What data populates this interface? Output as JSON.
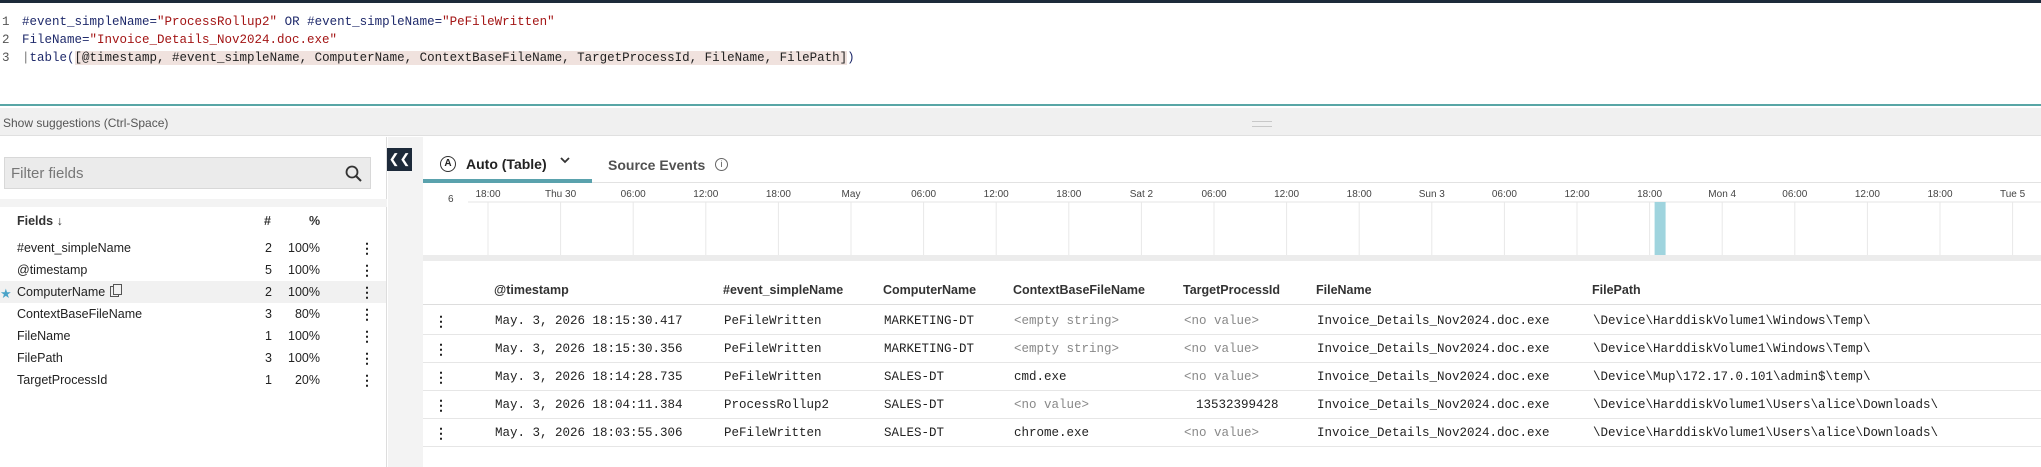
{
  "editor": {
    "lines": [
      {
        "num": "1",
        "parts": [
          [
            "txt",
            "#event_simpleName="
          ],
          [
            "str",
            "\"ProcessRollup2\""
          ],
          [
            "txt",
            " OR #event_simpleName="
          ],
          [
            "str",
            "\"PeFileWritten\""
          ]
        ]
      },
      {
        "num": "2",
        "parts": [
          [
            "txt",
            "FileName="
          ],
          [
            "str",
            "\"Invoice_Details_Nov2024.doc.exe\""
          ]
        ]
      },
      {
        "num": "3",
        "parts": [
          [
            "pipe",
            "|"
          ],
          [
            "txt",
            "table("
          ],
          [
            "hl",
            "[@timestamp, #event_simpleName, ComputerName, ContextBaseFileName, TargetProcessId, FileName, FilePath]"
          ],
          [
            "txt",
            ")"
          ]
        ]
      }
    ],
    "suggestions": "Show suggestions (Ctrl-Space)"
  },
  "fields_panel": {
    "filter_placeholder": "Filter fields",
    "headers": {
      "fields": "Fields",
      "count": "#",
      "pct": "%"
    },
    "items": [
      {
        "name": "#event_simpleName",
        "count": "2",
        "pct": "100%"
      },
      {
        "name": "@timestamp",
        "count": "5",
        "pct": "100%"
      },
      {
        "name": "ComputerName",
        "count": "2",
        "pct": "100%",
        "starred": true,
        "hover": true
      },
      {
        "name": "ContextBaseFileName",
        "count": "3",
        "pct": "80%"
      },
      {
        "name": "FileName",
        "count": "1",
        "pct": "100%"
      },
      {
        "name": "FilePath",
        "count": "3",
        "pct": "100%"
      },
      {
        "name": "TargetProcessId",
        "count": "1",
        "pct": "20%"
      }
    ]
  },
  "tabs": {
    "auto_icon": "A",
    "auto_label": "Auto (Table)",
    "source_label": "Source Events",
    "source_info": "i"
  },
  "timeline": {
    "y_max_label": "6",
    "ticks": [
      "18:00",
      "Thu 30",
      "06:00",
      "12:00",
      "18:00",
      "May",
      "06:00",
      "12:00",
      "18:00",
      "Sat 2",
      "06:00",
      "12:00",
      "18:00",
      "Sun 3",
      "06:00",
      "12:00",
      "18:00",
      "Mon 4",
      "06:00",
      "12:00",
      "18:00",
      "Tue 5"
    ],
    "bar_color": "#9fd4de",
    "bar_tick_index": 16,
    "bar_fraction": 1.0
  },
  "table": {
    "columns": [
      "@timestamp",
      "#event_simpleName",
      "ComputerName",
      "ContextBaseFileName",
      "TargetProcessId",
      "FileName",
      "FilePath"
    ],
    "rows": [
      {
        "ts": "May. 3, 2026 18:15:30.417",
        "ev": "PeFileWritten",
        "cn": "MARKETING-DT",
        "cbf": "<empty string>",
        "cbf_muted": true,
        "tpid": "<no value>",
        "tpid_muted": true,
        "fn": "Invoice_Details_Nov2024.doc.exe",
        "fp": "\\Device\\HarddiskVolume1\\Windows\\Temp\\"
      },
      {
        "ts": "May. 3, 2026 18:15:30.356",
        "ev": "PeFileWritten",
        "cn": "MARKETING-DT",
        "cbf": "<empty string>",
        "cbf_muted": true,
        "tpid": "<no value>",
        "tpid_muted": true,
        "fn": "Invoice_Details_Nov2024.doc.exe",
        "fp": "\\Device\\HarddiskVolume1\\Windows\\Temp\\"
      },
      {
        "ts": "May. 3, 2026 18:14:28.735",
        "ev": "PeFileWritten",
        "cn": "SALES-DT",
        "cbf": "cmd.exe",
        "cbf_muted": false,
        "tpid": "<no value>",
        "tpid_muted": true,
        "fn": "Invoice_Details_Nov2024.doc.exe",
        "fp": "\\Device\\Mup\\172.17.0.101\\admin$\\temp\\"
      },
      {
        "ts": "May. 3, 2026 18:04:11.384",
        "ev": "ProcessRollup2",
        "cn": "SALES-DT",
        "cbf": "<no value>",
        "cbf_muted": true,
        "tpid": "13532399428",
        "tpid_muted": false,
        "fn": "Invoice_Details_Nov2024.doc.exe",
        "fp": "\\Device\\HarddiskVolume1\\Users\\alice\\Downloads\\"
      },
      {
        "ts": "May. 3, 2026 18:03:55.306",
        "ev": "PeFileWritten",
        "cn": "SALES-DT",
        "cbf": "chrome.exe",
        "cbf_muted": false,
        "tpid": "<no value>",
        "tpid_muted": true,
        "fn": "Invoice_Details_Nov2024.doc.exe",
        "fp": "\\Device\\HarddiskVolume1\\Users\\alice\\Downloads\\"
      }
    ]
  }
}
